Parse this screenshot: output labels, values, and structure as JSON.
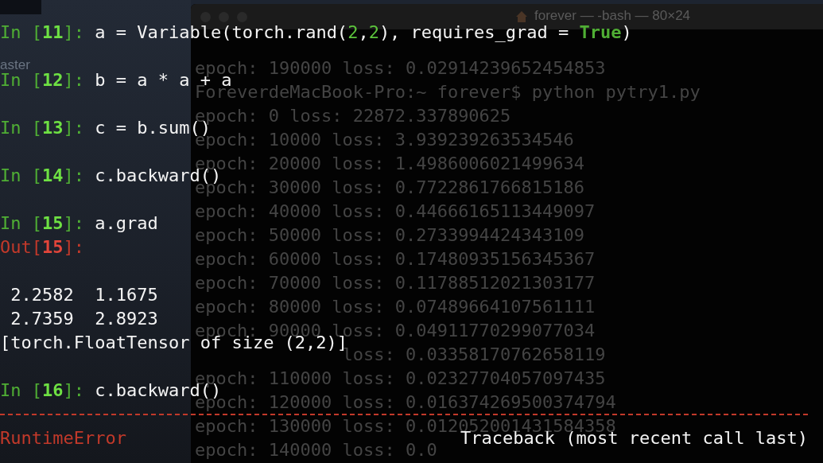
{
  "desktop_labels": [
    "aster"
  ],
  "background_window": {
    "title": "forever — -bash — 80×24",
    "lines": [
      {
        "text": "epoch: 190000 loss: 0.02914239652454853",
        "covered_left": false
      },
      {
        "text": "ForeverdeMacBook-Pro:~ forever$ python pytry1.py",
        "covered_left": false
      },
      {
        "text": "epoch: 0 loss: 22872.337890625",
        "covered_left": false
      },
      {
        "text": "epoch: 10000 loss: 3.939239263534546",
        "covered_left": false
      },
      {
        "text": "epoch: 20000 loss: 1.4986006021499634",
        "covered_left": false
      },
      {
        "text": "epoch: 30000 loss: 0.7722861766815186",
        "covered_left": false
      },
      {
        "text": "epoch: 40000 loss: 0.44666165113449097",
        "covered_left": false
      },
      {
        "text": "epoch: 50000 loss: 0.2733994424343109",
        "covered_left": false
      },
      {
        "text": "epoch: 60000 loss: 0.17480935156345367",
        "covered_left": false
      },
      {
        "text": "epoch: 70000 loss: 0.11788512021303177",
        "covered_left": false
      },
      {
        "text": "epoch: 80000 loss: 0.07489664107561111",
        "covered_left": false
      },
      {
        "text": "epoch: 90000 loss: 0.04911770299077034",
        "covered_left": false
      },
      {
        "text": "loss: 0.03358170762658119",
        "covered_left": true
      },
      {
        "text": "epoch: 110000 loss: 0.02327704057097435",
        "covered_left": false
      },
      {
        "text": "epoch: 120000 loss: 0.016374269500374794",
        "covered_left": false
      },
      {
        "text": "epoch: 130000 loss: 0.012052001431584358",
        "covered_left": false
      },
      {
        "text": "epoch: 140000 loss: 0.0",
        "covered_left": false
      }
    ]
  },
  "console": [
    {
      "kind": "input",
      "segments": [
        {
          "text": "In [",
          "kind": "prompt"
        },
        {
          "text": "11",
          "kind": "prompt-num"
        },
        {
          "text": "]: ",
          "kind": "prompt"
        },
        {
          "text": "a = Variable(torch.rand(",
          "kind": "plain"
        },
        {
          "text": "2",
          "kind": "number"
        },
        {
          "text": ",",
          "kind": "plain"
        },
        {
          "text": "2",
          "kind": "number"
        },
        {
          "text": "), requires_grad = ",
          "kind": "plain"
        },
        {
          "text": "True",
          "kind": "keyword"
        },
        {
          "text": ")",
          "kind": "plain"
        }
      ]
    },
    {
      "kind": "blank"
    },
    {
      "kind": "input",
      "segments": [
        {
          "text": "In [",
          "kind": "prompt"
        },
        {
          "text": "12",
          "kind": "prompt-num"
        },
        {
          "text": "]: ",
          "kind": "prompt"
        },
        {
          "text": "b = a * a + a",
          "kind": "plain"
        }
      ]
    },
    {
      "kind": "blank"
    },
    {
      "kind": "input",
      "segments": [
        {
          "text": "In [",
          "kind": "prompt"
        },
        {
          "text": "13",
          "kind": "prompt-num"
        },
        {
          "text": "]: ",
          "kind": "prompt"
        },
        {
          "text": "c = b.sum()",
          "kind": "plain"
        }
      ]
    },
    {
      "kind": "blank"
    },
    {
      "kind": "input",
      "segments": [
        {
          "text": "In [",
          "kind": "prompt"
        },
        {
          "text": "14",
          "kind": "prompt-num"
        },
        {
          "text": "]: ",
          "kind": "prompt"
        },
        {
          "text": "c.backward()",
          "kind": "plain"
        }
      ]
    },
    {
      "kind": "blank"
    },
    {
      "kind": "input",
      "segments": [
        {
          "text": "In [",
          "kind": "prompt"
        },
        {
          "text": "15",
          "kind": "prompt-num"
        },
        {
          "text": "]: ",
          "kind": "prompt"
        },
        {
          "text": "a.grad",
          "kind": "plain"
        }
      ]
    },
    {
      "kind": "output-prompt",
      "segments": [
        {
          "text": "Out[",
          "kind": "out"
        },
        {
          "text": "15",
          "kind": "out-num"
        },
        {
          "text": "]:",
          "kind": "out"
        }
      ]
    },
    {
      "kind": "blank"
    },
    {
      "kind": "output",
      "segments": [
        {
          "text": " 2.2582  1.1675",
          "kind": "plain"
        }
      ]
    },
    {
      "kind": "output",
      "segments": [
        {
          "text": " 2.7359  2.8923",
          "kind": "plain"
        }
      ]
    },
    {
      "kind": "output",
      "segments": [
        {
          "text": "[torch.FloatTensor of size (2,2)]",
          "kind": "plain"
        }
      ]
    },
    {
      "kind": "blank"
    },
    {
      "kind": "input",
      "segments": [
        {
          "text": "In [",
          "kind": "prompt"
        },
        {
          "text": "16",
          "kind": "prompt-num"
        },
        {
          "text": "]: ",
          "kind": "prompt"
        },
        {
          "text": "c.backward()",
          "kind": "plain"
        }
      ]
    },
    {
      "kind": "rule"
    },
    {
      "kind": "error",
      "segments": [
        {
          "text": "RuntimeError",
          "kind": "out"
        },
        {
          "text": "Traceback (most recent call last)",
          "kind": "plain"
        }
      ]
    }
  ]
}
